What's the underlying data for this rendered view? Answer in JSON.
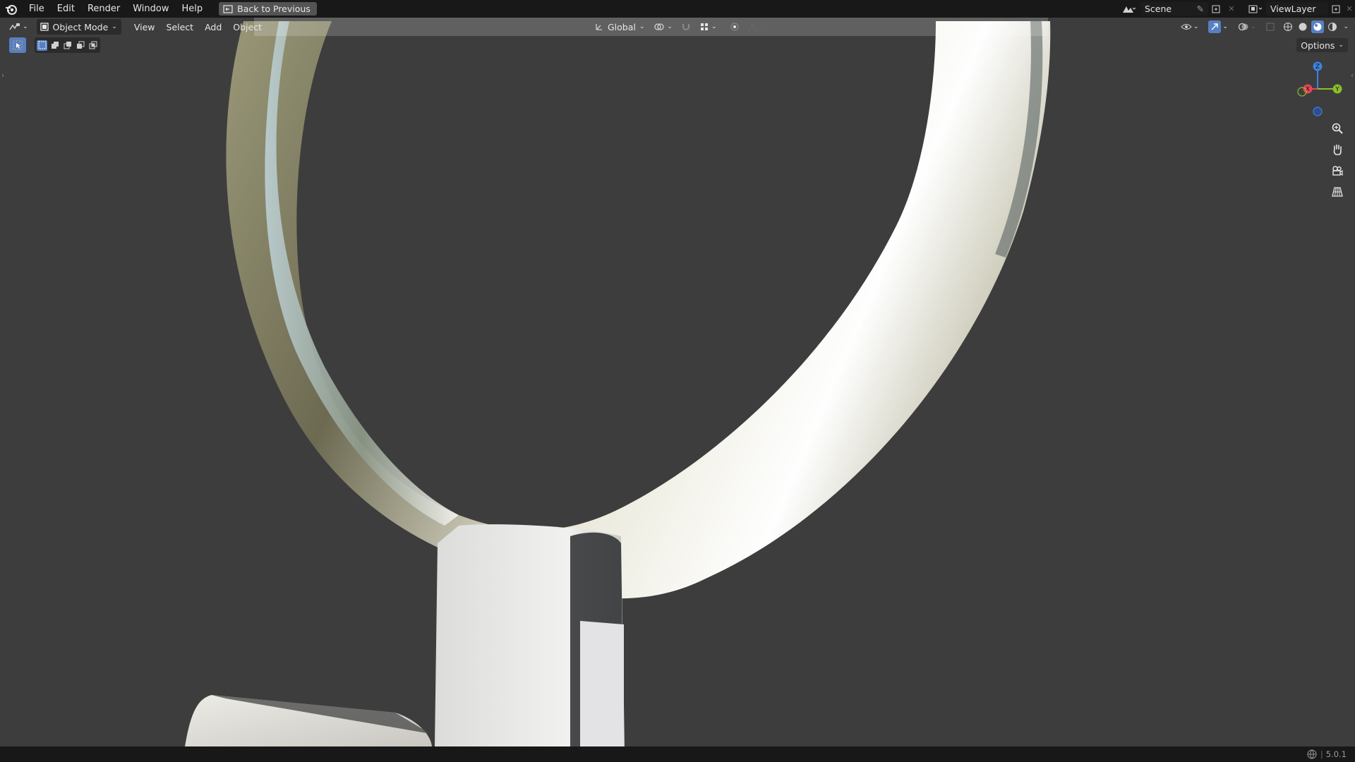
{
  "menus": [
    "File",
    "Edit",
    "Render",
    "Window",
    "Help"
  ],
  "back_button": "Back to Previous",
  "scene": {
    "label": "Scene"
  },
  "view_layer": {
    "label": "ViewLayer"
  },
  "viewport": {
    "mode": "Object Mode",
    "menus": [
      "View",
      "Select",
      "Add",
      "Object"
    ],
    "transform_orientation": "Global",
    "options_label": "Options"
  },
  "gizmo": {
    "x": "X",
    "y": "Y",
    "z": "Z",
    "x_color": "#e8455a",
    "y_color": "#8ac027",
    "z_color": "#3d82e0"
  },
  "version": "5.0.1",
  "colors": {
    "accent": "#5680c2",
    "background": "#3d3d3d",
    "topbar": "#181818"
  }
}
